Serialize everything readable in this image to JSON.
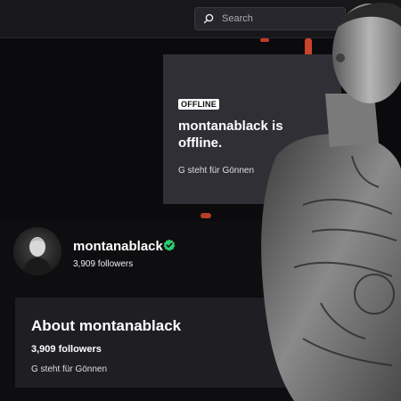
{
  "header": {
    "search_placeholder": "Search",
    "search_icon": "search-icon"
  },
  "offline_card": {
    "badge": "OFFLINE",
    "title": "montanablack is offline.",
    "subtitle": "G steht für Gönnen"
  },
  "channel": {
    "name": "montanablack",
    "followers": "3,909 followers",
    "verified_icon": "verified-check-icon",
    "verified_color": "#2ecc71"
  },
  "about": {
    "title": "About montanablack",
    "followers": "3,909 followers",
    "description": "G steht für Gönnen"
  },
  "colors": {
    "background": "#0e0e10",
    "card": "#2f2f35",
    "about_card": "#1f1f23"
  }
}
